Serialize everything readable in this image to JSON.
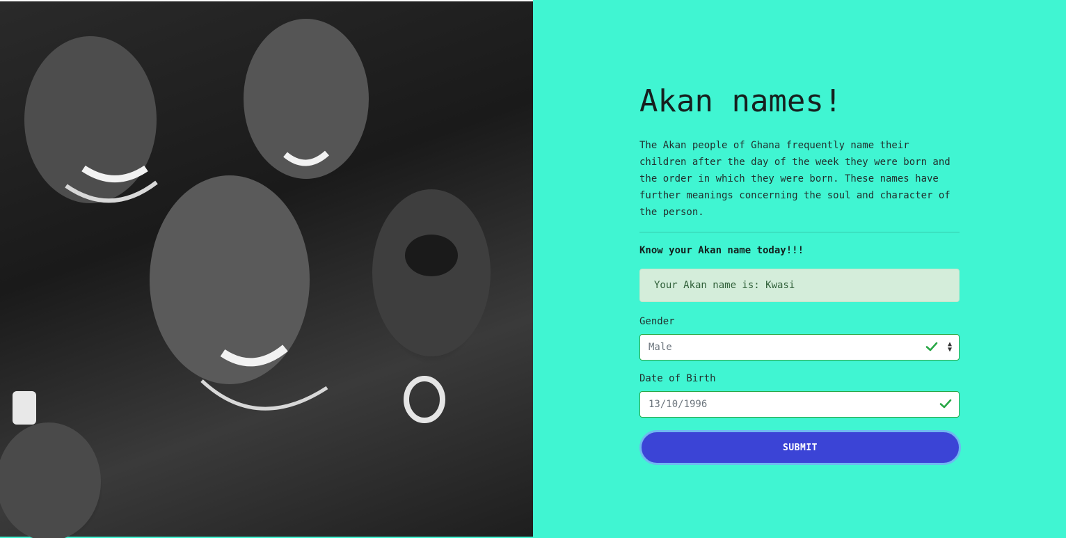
{
  "hero": {
    "image_alt": "Black and white photo of smiling children"
  },
  "main": {
    "title": "Akan names!",
    "description": "The Akan people of Ghana frequently name their children after the day of the week they were born and the order in which they were born. These names have further meanings concerning the soul and character of the person.",
    "cta": "Know your Akan name today!!!",
    "result": "Your Akan name is: Kwasi"
  },
  "form": {
    "gender_label": "Gender",
    "gender_value": "Male",
    "dob_label": "Date of Birth",
    "dob_value": "13/10/1996",
    "submit_label": "SUBMIT"
  },
  "colors": {
    "background": "#40f5d2",
    "success": "#28a745",
    "result_bg": "#d4edda",
    "button": "#3b44d6"
  },
  "icons": [
    "check-icon",
    "select-caret-icon"
  ]
}
